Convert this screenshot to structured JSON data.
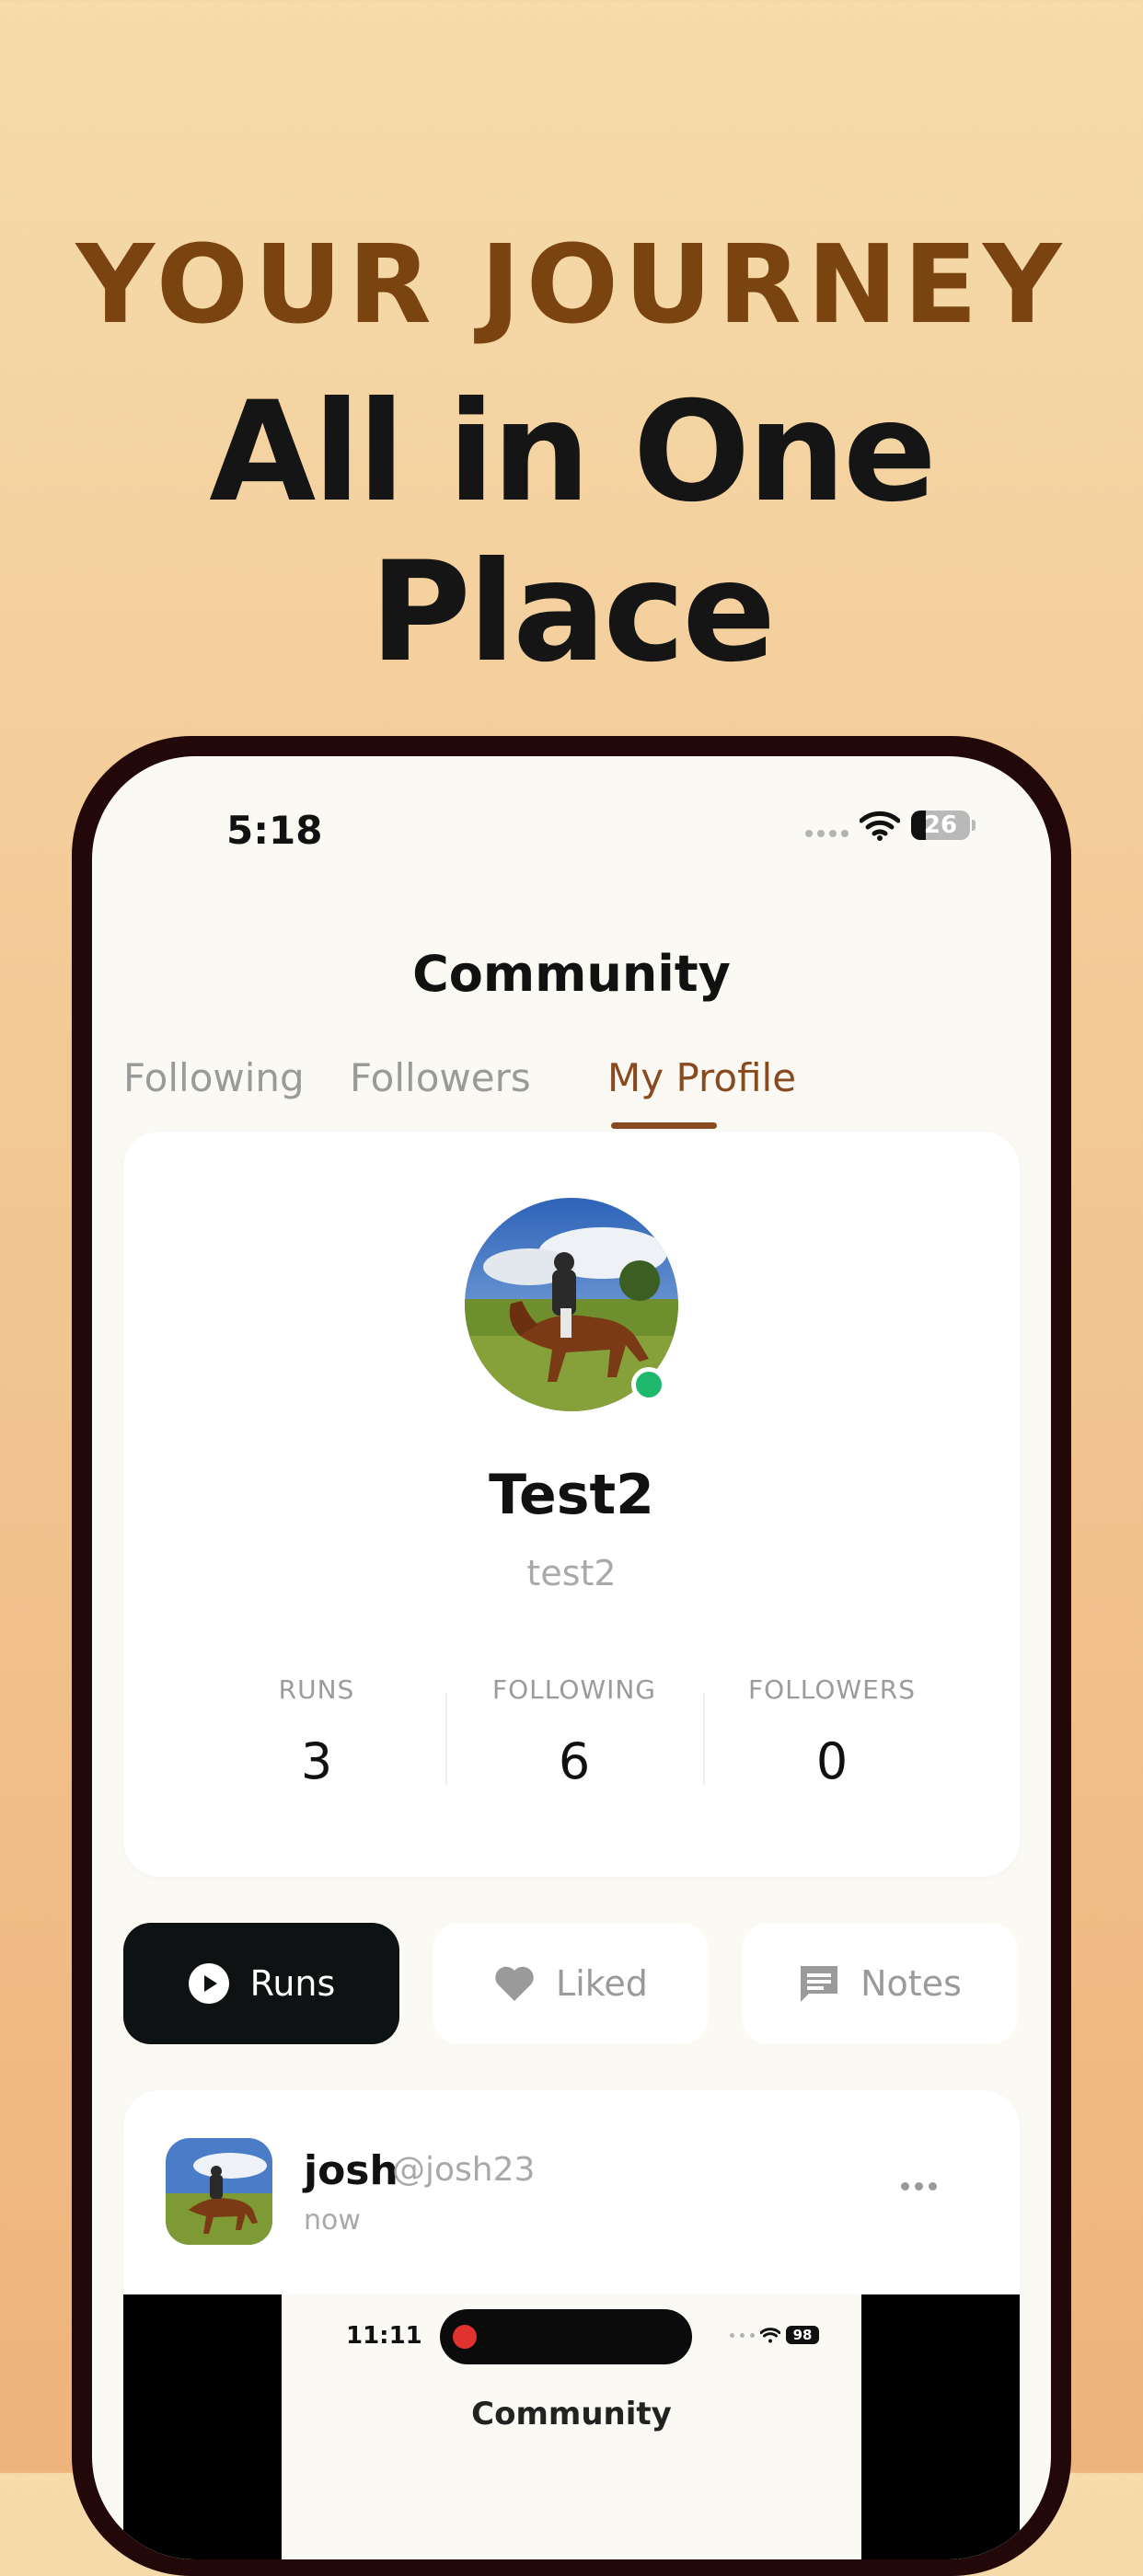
{
  "hero": {
    "eyebrow": "YOUR JOURNEY",
    "headline": "All in One Place"
  },
  "status_bar": {
    "time": "5:18",
    "battery": "26"
  },
  "header": {
    "title": "Community"
  },
  "tabs": [
    {
      "label": "Following",
      "active": false
    },
    {
      "label": "Followers",
      "active": false
    },
    {
      "label": "My Profile",
      "active": true
    }
  ],
  "profile": {
    "name": "Test2",
    "handle": "test2",
    "online": true,
    "stats": [
      {
        "label": "RUNS",
        "value": "3"
      },
      {
        "label": "FOLLOWING",
        "value": "6"
      },
      {
        "label": "FOLLOWERS",
        "value": "0"
      }
    ]
  },
  "filters": [
    {
      "label": "Runs",
      "icon": "play-circle-icon",
      "active": true
    },
    {
      "label": "Liked",
      "icon": "heart-icon",
      "active": false
    },
    {
      "label": "Notes",
      "icon": "message-icon",
      "active": false
    }
  ],
  "post": {
    "user": "josh",
    "handle": "@josh23",
    "time": "now",
    "preview": {
      "time": "11:11",
      "battery": "98",
      "title": "Community"
    }
  },
  "colors": {
    "accent": "#8a4a1f",
    "hero_eyebrow": "#7a4410",
    "online": "#1db86b",
    "active_pill": "#0e1212"
  }
}
